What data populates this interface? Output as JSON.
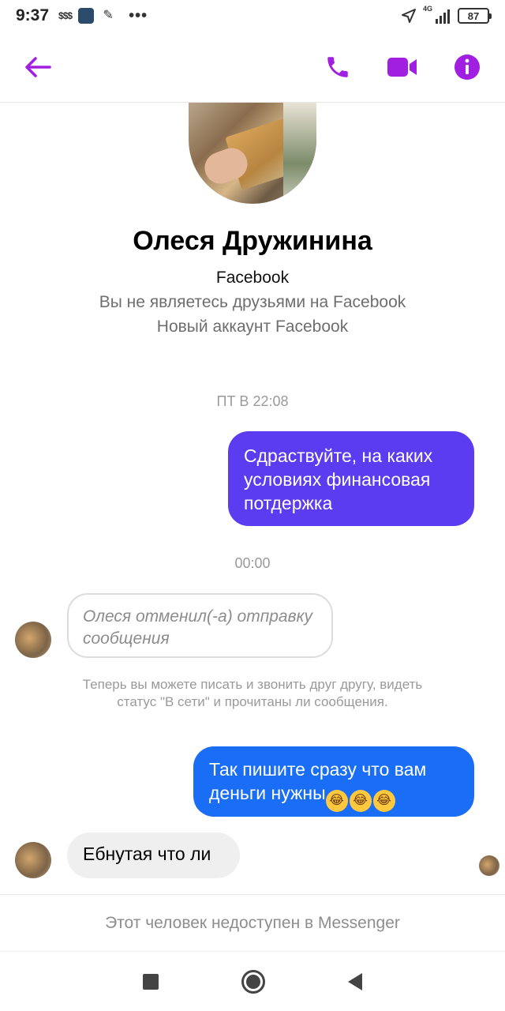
{
  "status_bar": {
    "time": "9:37",
    "left_icons": [
      "dollar-icon",
      "app-icon",
      "app-icon",
      "more-icon"
    ],
    "dollar_text": "$$$",
    "more_text": "•••",
    "network": "4G",
    "battery": "87"
  },
  "header": {
    "back_icon": "back-arrow-icon",
    "actions": [
      "phone-icon",
      "video-icon",
      "info-icon"
    ],
    "accent_color": "#a01fe0"
  },
  "profile": {
    "name": "Олеся Дружинина",
    "source": "Facebook",
    "line1": "Вы не являетесь друзьями на Facebook",
    "line2": "Новый аккаунт Facebook"
  },
  "messages": {
    "timestamp1": "ПТ В 22:08",
    "outgoing1": "Сдраствуйте, на каких условиях финансовая потдержка",
    "timestamp2": "00:00",
    "removed": "Олеся отменил(-а) отправку сообщения",
    "system_note": "Теперь вы можете писать и звонить друг другу, видеть статус \"В сети\" и прочитаны ли сообщения.",
    "outgoing2": "Так пишите сразу что вам деньги нужны",
    "emoji_count": 3,
    "emoji_name": "laughing-emoji",
    "emoji_glyph": "😂",
    "incoming1": "Ебнутая что ли"
  },
  "footer": {
    "unavailable": "Этот человек недоступен в Messenger"
  },
  "colors": {
    "bubble_out_1": "#5b3cf0",
    "bubble_out_2": "#1a6ef5",
    "bubble_in": "#efefef"
  }
}
